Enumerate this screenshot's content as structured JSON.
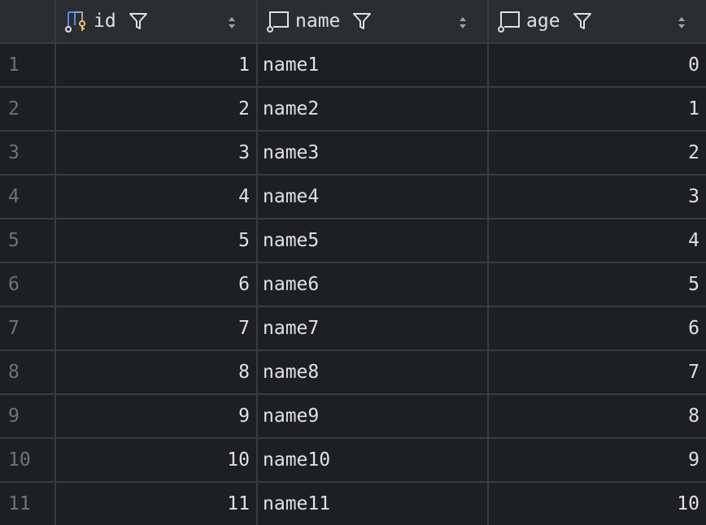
{
  "columns": [
    {
      "key": "id",
      "label": "id",
      "kind": "primary-key"
    },
    {
      "key": "name",
      "label": "name",
      "kind": "column"
    },
    {
      "key": "age",
      "label": "age",
      "kind": "column"
    }
  ],
  "rows": [
    {
      "num": "1",
      "id": "1",
      "name": "name1",
      "age": "0"
    },
    {
      "num": "2",
      "id": "2",
      "name": "name2",
      "age": "1"
    },
    {
      "num": "3",
      "id": "3",
      "name": "name3",
      "age": "2"
    },
    {
      "num": "4",
      "id": "4",
      "name": "name4",
      "age": "3"
    },
    {
      "num": "5",
      "id": "5",
      "name": "name5",
      "age": "4"
    },
    {
      "num": "6",
      "id": "6",
      "name": "name6",
      "age": "5"
    },
    {
      "num": "7",
      "id": "7",
      "name": "name7",
      "age": "6"
    },
    {
      "num": "8",
      "id": "8",
      "name": "name8",
      "age": "7"
    },
    {
      "num": "9",
      "id": "9",
      "name": "name9",
      "age": "8"
    },
    {
      "num": "10",
      "id": "10",
      "name": "name10",
      "age": "9"
    },
    {
      "num": "11",
      "id": "11",
      "name": "name11",
      "age": "10"
    }
  ],
  "icons": {
    "primary_key_column": "key-column-icon",
    "column": "column-icon",
    "filter": "filter-icon",
    "sort": "sort-icon"
  },
  "colors": {
    "background": "#1e1f22",
    "header": "#2b2d30",
    "gridline": "#393b40",
    "text": "#dfe1e5",
    "row_number": "#6f737a",
    "key_accent": "#e5c07b",
    "column_icon_accent": "#548af7"
  }
}
